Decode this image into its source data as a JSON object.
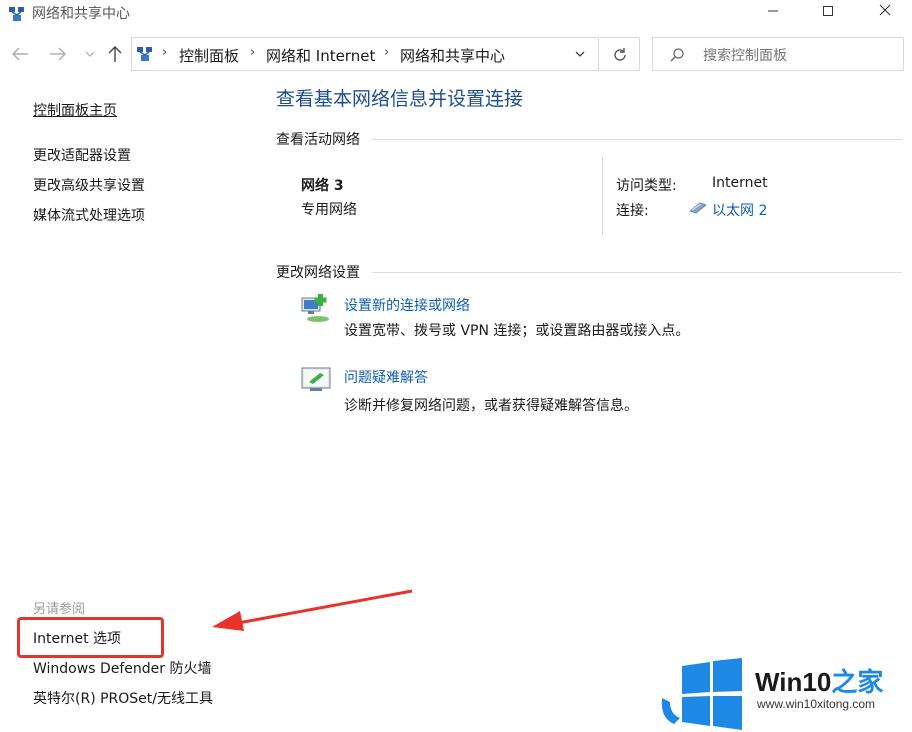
{
  "window": {
    "title": "网络和共享中心"
  },
  "navigation": {
    "breadcrumb": [
      "控制面板",
      "网络和 Internet",
      "网络和共享中心"
    ],
    "search_placeholder": "搜索控制面板"
  },
  "sidebar": {
    "home": "控制面板主页",
    "items": [
      "更改适配器设置",
      "更改高级共享设置",
      "媒体流式处理选项"
    ],
    "see_also_label": "另请参阅",
    "see_also": [
      "Internet 选项",
      "Windows Defender 防火墙",
      "英特尔(R) PROSet/无线工具"
    ]
  },
  "main": {
    "heading": "查看基本网络信息并设置连接",
    "active_section": "查看活动网络",
    "network": {
      "name": "网络 3",
      "type": "专用网络",
      "access_label": "访问类型:",
      "access_value": "Internet",
      "connection_label": "连接:",
      "connection_value": "以太网 2"
    },
    "settings_section": "更改网络设置",
    "tasks": [
      {
        "title": "设置新的连接或网络",
        "desc": "设置宽带、拨号或 VPN 连接；或设置路由器或接入点。"
      },
      {
        "title": "问题疑难解答",
        "desc": "诊断并修复网络问题，或者获得疑难解答信息。"
      }
    ]
  },
  "watermark": {
    "title_prefix": "Win10",
    "title_suffix": "之家",
    "url": "www.win10xitong.com"
  },
  "colors": {
    "link": "#0f5fb0",
    "heading": "#1e4f8c",
    "highlight": "#e8332a",
    "brand_blue": "#1e88e5"
  }
}
